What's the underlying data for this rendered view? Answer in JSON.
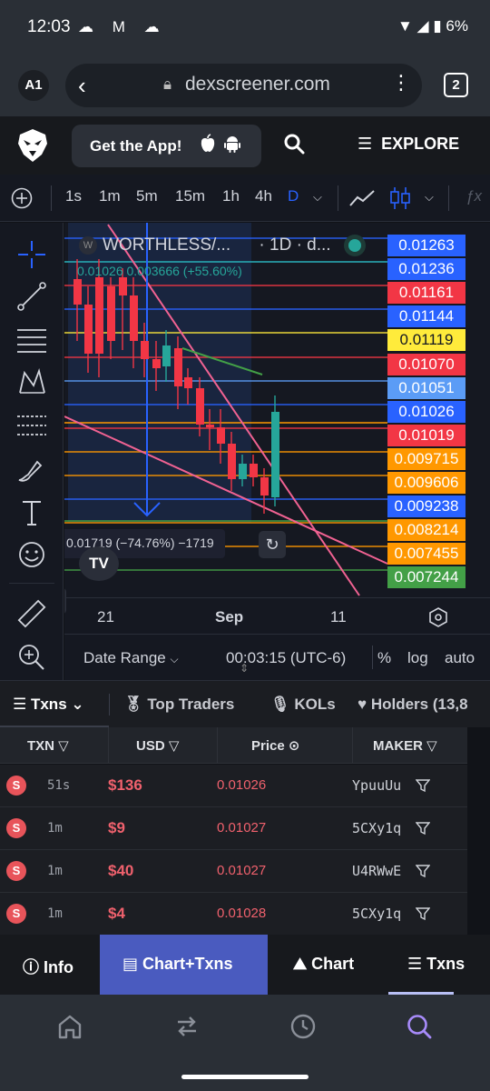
{
  "status_bar": {
    "time": "12:03",
    "battery": "6%"
  },
  "browser": {
    "profile": "A1",
    "url": "dexscreener.com",
    "tab_count": "2"
  },
  "header": {
    "get_app_label": "Get the App!",
    "explore_label": "EXPLORE"
  },
  "chart_toolbar": {
    "intervals": [
      "1s",
      "1m",
      "5m",
      "15m",
      "1h",
      "4h",
      "D"
    ],
    "active_interval": "D"
  },
  "chart": {
    "symbol": "WORTHLESS/...",
    "timeframe": "· 1D · d...",
    "price_change": "0.01026  0.003666 (+55.60%)",
    "measure_readout": "0.01719 (−74.76%) −1719",
    "price_labels": [
      {
        "value": "0.01263",
        "color": "#2962ff"
      },
      {
        "value": "0.01236",
        "color": "#2962ff"
      },
      {
        "value": "0.01161",
        "color": "#f23645"
      },
      {
        "value": "0.01144",
        "color": "#2962ff"
      },
      {
        "value": "0.01119",
        "color": "#ffeb3b"
      },
      {
        "value": "0.01070",
        "color": "#f23645"
      },
      {
        "value": "0.01051",
        "color": "#5b9cf6"
      },
      {
        "value": "0.01026",
        "color": "#2962ff"
      },
      {
        "value": "0.01019",
        "color": "#f23645"
      },
      {
        "value": "0.009715",
        "color": "#ff9800"
      },
      {
        "value": "0.009606",
        "color": "#ff9800"
      },
      {
        "value": "0.009238",
        "color": "#2962ff"
      },
      {
        "value": "0.008214",
        "color": "#ff9800"
      },
      {
        "value": "0.007455",
        "color": "#ff9800"
      },
      {
        "value": "0.007244",
        "color": "#43a047"
      }
    ],
    "time_labels": [
      "21",
      "Sep",
      "11"
    ],
    "date_range_label": "Date Range",
    "clock": "00:03:15 (UTC-6)",
    "percent_label": "%",
    "log_label": "log",
    "auto_label": "auto"
  },
  "txn_tabs": [
    "Txns",
    "Top Traders",
    "KOLs",
    "Holders (13,8"
  ],
  "table": {
    "headers": [
      "TXN",
      "USD",
      "Price",
      "MAKER"
    ],
    "rows": [
      {
        "type": "S",
        "age": "51s",
        "usd": "$136",
        "price": "0.01026",
        "maker": "YpuuUu"
      },
      {
        "type": "S",
        "age": "1m",
        "usd": "$9",
        "price": "0.01027",
        "maker": "5CXy1q"
      },
      {
        "type": "S",
        "age": "1m",
        "usd": "$40",
        "price": "0.01027",
        "maker": "U4RWwE"
      },
      {
        "type": "S",
        "age": "1m",
        "usd": "$4",
        "price": "0.01028",
        "maker": "5CXy1q"
      }
    ]
  },
  "app_tabs": [
    "Info",
    "Chart+Txns",
    "Chart",
    "Txns"
  ],
  "icons": [
    "home-icon",
    "swap-icon",
    "history-icon",
    "search-icon"
  ]
}
